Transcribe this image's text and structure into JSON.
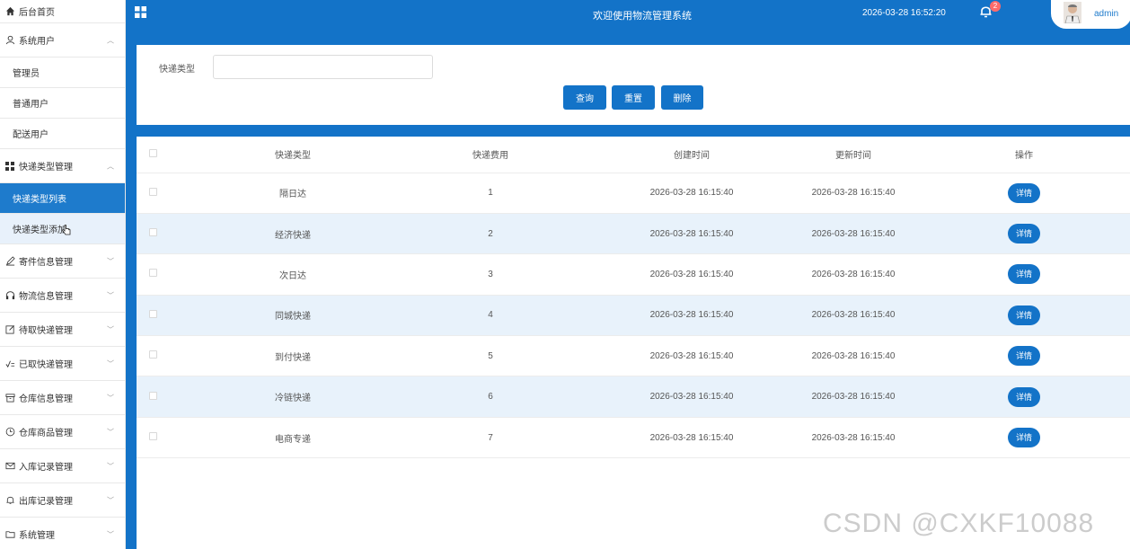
{
  "sidebar": {
    "home": "后台首页",
    "groups": [
      {
        "label": "系统用户",
        "icon": "user-icon",
        "expanded": true,
        "children": [
          "管理员",
          "普通用户",
          "配送用户"
        ]
      },
      {
        "label": "快递类型管理",
        "icon": "grid-icon",
        "expanded": true,
        "children": [
          "快递类型列表",
          "快递类型添加"
        ]
      },
      {
        "label": "寄件信息管理",
        "icon": "pen-icon"
      },
      {
        "label": "物流信息管理",
        "icon": "headset-icon"
      },
      {
        "label": "待取快递管理",
        "icon": "edit-icon"
      },
      {
        "label": "已取快递管理",
        "icon": "check-list-icon"
      },
      {
        "label": "仓库信息管理",
        "icon": "archive-icon"
      },
      {
        "label": "仓库商品管理",
        "icon": "clock-icon"
      },
      {
        "label": "入库记录管理",
        "icon": "mail-icon"
      },
      {
        "label": "出库记录管理",
        "icon": "bell-icon"
      },
      {
        "label": "系统管理",
        "icon": "folder-icon"
      }
    ]
  },
  "header": {
    "title": "欢迎使用物流管理系统",
    "datetime": "2026-03-28 16:52:20",
    "notification_count": "2",
    "username": "admin"
  },
  "search": {
    "label": "快递类型",
    "value": "",
    "buttons": {
      "query": "查询",
      "reset": "重置",
      "delete": "删除"
    }
  },
  "table": {
    "headers": [
      "快递类型",
      "快递费用",
      "创建时间",
      "更新时间",
      "操作"
    ],
    "detail_label": "详情",
    "rows": [
      {
        "type": "隔日达",
        "fee": "1",
        "created": "2026-03-28 16:15:40",
        "updated": "2026-03-28 16:15:40"
      },
      {
        "type": "经济快递",
        "fee": "2",
        "created": "2026-03-28 16:15:40",
        "updated": "2026-03-28 16:15:40"
      },
      {
        "type": "次日达",
        "fee": "3",
        "created": "2026-03-28 16:15:40",
        "updated": "2026-03-28 16:15:40"
      },
      {
        "type": "同城快递",
        "fee": "4",
        "created": "2026-03-28 16:15:40",
        "updated": "2026-03-28 16:15:40"
      },
      {
        "type": "到付快递",
        "fee": "5",
        "created": "2026-03-28 16:15:40",
        "updated": "2026-03-28 16:15:40"
      },
      {
        "type": "冷链快递",
        "fee": "6",
        "created": "2026-03-28 16:15:40",
        "updated": "2026-03-28 16:15:40"
      },
      {
        "type": "电商专递",
        "fee": "7",
        "created": "2026-03-28 16:15:40",
        "updated": "2026-03-28 16:15:40"
      }
    ]
  },
  "colors": {
    "primary": "#1373c8",
    "row_alt": "#e8f2fb"
  },
  "watermark": "CSDN @CXKF10088"
}
